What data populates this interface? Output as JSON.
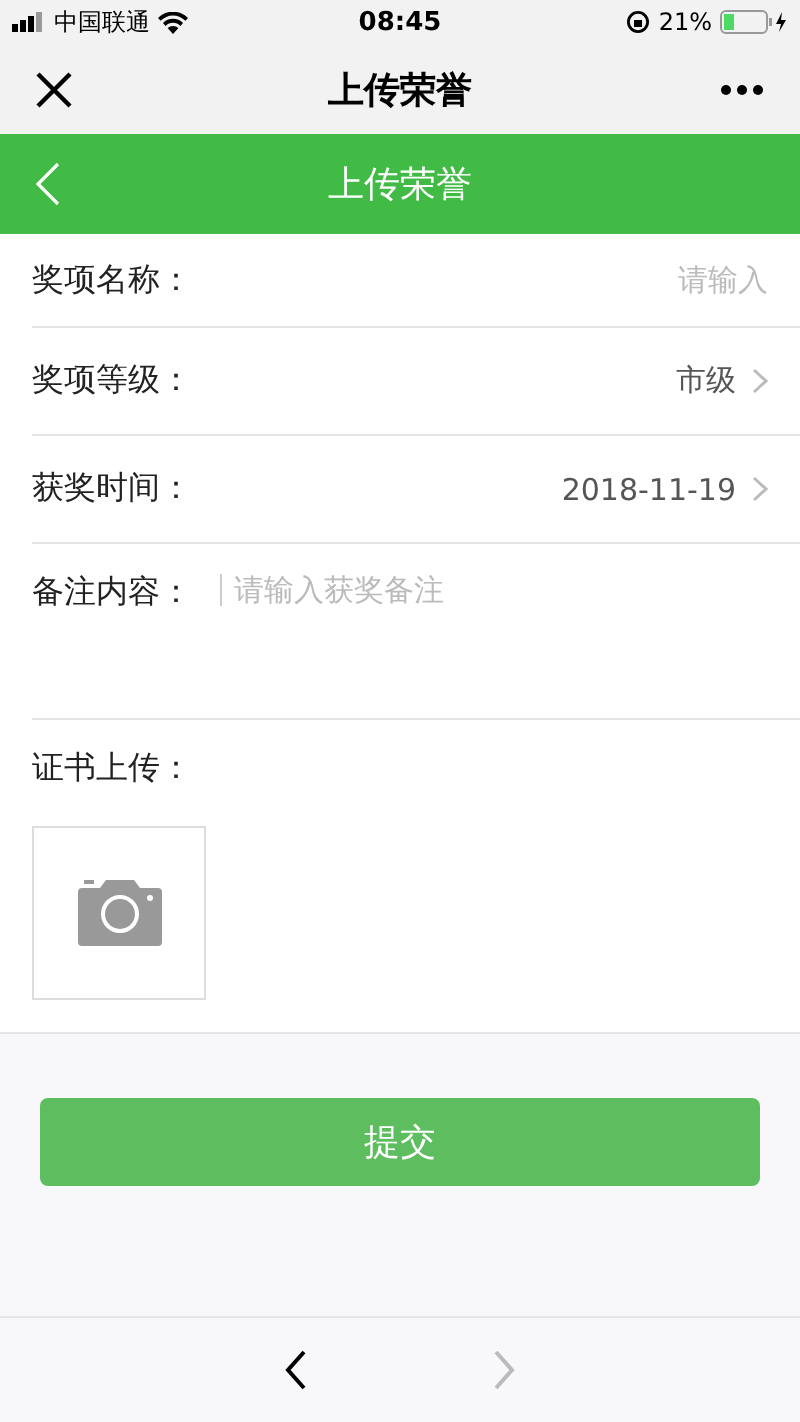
{
  "status_bar": {
    "carrier": "中国联通",
    "time": "08:45",
    "battery": "21%"
  },
  "wechat_bar": {
    "title": "上传荣誉"
  },
  "header": {
    "title": "上传荣誉"
  },
  "form": {
    "rows": [
      {
        "kind": "input",
        "label": "奖项名称：",
        "placeholder": "请输入"
      },
      {
        "kind": "select",
        "label": "奖项等级：",
        "value": "市级"
      },
      {
        "kind": "select",
        "label": "获奖时间：",
        "value": "2018-11-19"
      },
      {
        "kind": "textarea",
        "label": "备注内容：",
        "placeholder": "请输入获奖备注"
      }
    ]
  },
  "upload": {
    "label": "证书上传："
  },
  "submit_button": "提交",
  "browser_nav": [
    {
      "kind": "back",
      "disabled": false
    },
    {
      "kind": "forward",
      "disabled": true
    }
  ]
}
